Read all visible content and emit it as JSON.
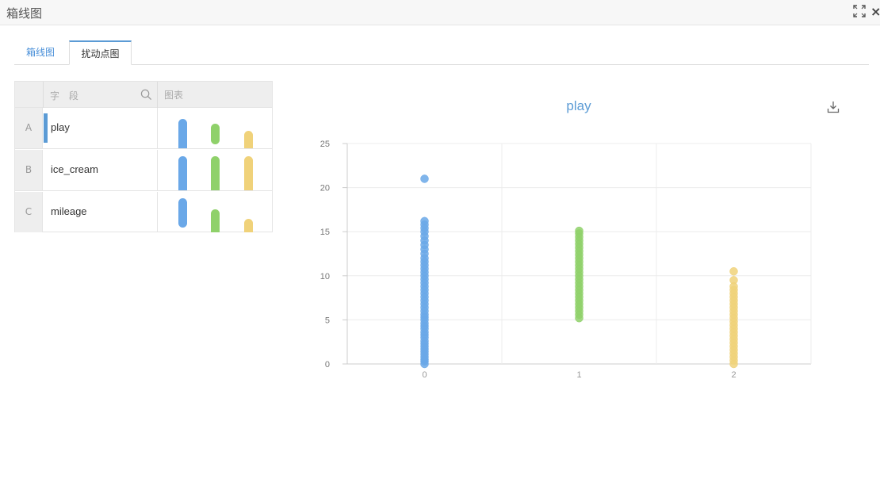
{
  "window": {
    "title": "箱线图",
    "expand_icon": "expand-icon",
    "close_label": "×"
  },
  "tabs": [
    {
      "label": "箱线图",
      "active": false
    },
    {
      "label": "扰动点图",
      "active": true
    }
  ],
  "field_table": {
    "header_field": "字 段",
    "header_chart": "图表",
    "search_icon": "search-icon",
    "rows": [
      {
        "index": "A",
        "name": "play",
        "selected": true
      },
      {
        "index": "B",
        "name": "ice_cream",
        "selected": false
      },
      {
        "index": "C",
        "name": "mileage",
        "selected": false
      }
    ]
  },
  "colors": {
    "series0": "#6aa8e8",
    "series1": "#8fd16a",
    "series2": "#f0d27a",
    "accent": "#5b9bd5"
  },
  "chart_data": {
    "type": "scatter",
    "title": "play",
    "x": [
      0,
      1,
      2
    ],
    "xtick_labels": [
      "0",
      "1",
      "2"
    ],
    "ylim": [
      0,
      25
    ],
    "yticks": [
      0,
      5,
      10,
      15,
      20,
      25
    ],
    "grid": true,
    "series": [
      {
        "x": 0,
        "color": "#6aa8e8",
        "values": [
          0,
          0.3,
          0.5,
          0.8,
          1.1,
          1.4,
          1.7,
          2,
          2.3,
          2.6,
          3,
          3.3,
          3.6,
          4,
          4.3,
          4.6,
          5,
          5.3,
          5.6,
          6,
          6.4,
          6.8,
          7.2,
          7.6,
          8,
          8.4,
          8.8,
          9.2,
          9.6,
          10,
          10.4,
          10.8,
          11.2,
          11.6,
          12,
          12.5,
          13,
          13.5,
          14,
          14.5,
          15,
          15.4,
          15.8,
          16.2,
          21
        ]
      },
      {
        "x": 1,
        "color": "#8fd16a",
        "values": [
          5.2,
          5.6,
          6,
          6.4,
          6.8,
          7.2,
          7.6,
          8,
          8.4,
          8.8,
          9.2,
          9.6,
          10,
          10.4,
          10.8,
          11.2,
          11.6,
          12,
          12.4,
          12.8,
          13.2,
          13.6,
          14,
          14.4,
          14.8,
          15.1
        ]
      },
      {
        "x": 2,
        "color": "#f0d27a",
        "values": [
          0,
          0.4,
          0.8,
          1.2,
          1.6,
          2,
          2.4,
          2.8,
          3.2,
          3.6,
          4,
          4.4,
          4.8,
          5.2,
          5.6,
          6,
          6.4,
          6.8,
          7.2,
          7.6,
          8,
          8.4,
          8.8,
          9.5,
          10.5
        ]
      }
    ]
  },
  "download_icon": "download-icon"
}
